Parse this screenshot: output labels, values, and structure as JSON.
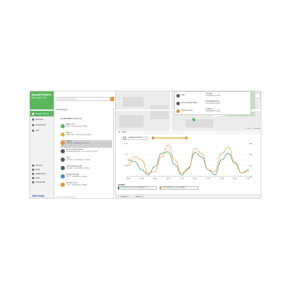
{
  "brand": {
    "logo": "Aqua4Forward",
    "subtitle": "Data Logger v1.70"
  },
  "nav": {
    "items": [
      {
        "label": "Visualizzazione",
        "active": true,
        "icon": "eye-icon"
      },
      {
        "label": "Informes",
        "active": false,
        "icon": "report-icon"
      },
      {
        "label": "Dispositivos",
        "active": false,
        "icon": "device-icon"
      },
      {
        "label": "API",
        "active": false,
        "icon": "api-icon"
      }
    ],
    "bottom": [
      {
        "label": "Account",
        "icon": "user-icon"
      },
      {
        "label": "Pixel",
        "icon": "pixel-icon"
      },
      {
        "label": "Applications",
        "icon": "apps-icon"
      },
      {
        "label": "Help",
        "icon": "help-icon"
      },
      {
        "label": "Français(ü)",
        "icon": "language-icon"
      }
    ],
    "footer_logo": "Sydrologic"
  },
  "tree": {
    "search_placeholder": "Rechercher filtre dans...",
    "root": "Hydrologic",
    "device": "DVDF0MBK2-PLUTO-04",
    "sensors": [
      {
        "name": "Battery Life",
        "value": "81 % - 11-06-2024 12:28:50",
        "color": "#5cb85c",
        "selected": false
      },
      {
        "name": "Shelter",
        "value": "0.836 mAh - 11-06-2024 12:28:50",
        "color": "#e8b13a",
        "selected": false
      },
      {
        "name": "Capteur",
        "value": "0.80 kN - 11-08-2024 12:27:30",
        "color": "#e8922b",
        "selected": true
      },
      {
        "name": "Communication Status",
        "value": "ACCESSAPP0012 - 10-07-2024 12:28:50",
        "color": "#555555",
        "selected": false
      },
      {
        "name": "GPS",
        "value": "Cd Neigs - 11-08-2024 12:28:50",
        "color": "#555555",
        "selected": false
      },
      {
        "name": "GSM Signal Strength",
        "value": "-82 dBm - 11-08-2024 12:28:50",
        "color": "#555555",
        "selected": false
      },
      {
        "name": "Relative Humidity",
        "value": "79 % - 11-08-2024 12:28:50",
        "color": "#3a8fd8",
        "selected": false
      },
      {
        "name": "Pressure / RT-1",
        "value": "1 bar - 09-08-2023 11:28:50",
        "color": "#e8922b",
        "selected": false
      }
    ],
    "footer": "© Reliure nel rechargement"
  },
  "map": {
    "popup": [
      {
        "name": "GPS",
        "v1": "Cd Neigs",
        "v2": "11-08-2024 12:28:50",
        "color": "#555555"
      },
      {
        "name": "Communication Status",
        "v1": "ACCESSAPP0012",
        "v2": "10-07-2024 12:28:50",
        "color": "#555555"
      },
      {
        "name": "Pressure / RT-1",
        "v1": "10.000 psi",
        "v2": "09-08-2023 11:28:50",
        "color": "#e8922b"
      }
    ],
    "attribution": "Leaflet | © OpenStreetMap"
  },
  "chart_header": "Zoom",
  "panel": {
    "range_label": "Range de Partout"
  },
  "chart_data": {
    "type": "line",
    "x": [
      "11:00",
      "11:02",
      "11:04",
      "11:06",
      "11:08",
      "11:10",
      "11:12",
      "11:14",
      "11:16",
      "11:18",
      "11:20",
      "11:22",
      "11:24",
      "11:26",
      "11:28",
      "11:30",
      "11:32",
      "11:34",
      "11:36"
    ],
    "categories_ticks": [
      "11:00",
      "11:04",
      "11:08",
      "11:12",
      "11:16",
      "11:20",
      "11:24",
      "11:28",
      "11:32",
      "11:36"
    ],
    "series": [
      {
        "name": "DVDF0MBK2-PLUTO-04 - Pression RT-1",
        "color": "#2e8b57",
        "values": [
          0.5,
          0.45,
          0.2,
          0.05,
          0.3,
          0.7,
          0.75,
          0.35,
          0.05,
          0.25,
          0.72,
          0.6,
          0.2,
          0.05,
          0.5,
          0.7,
          0.4,
          0.1,
          0.2
        ]
      },
      {
        "name": "DVDF0MBK2-PLUTO-04 - Capteur",
        "color": "#e8922b",
        "values": [
          0.35,
          0.6,
          0.5,
          0.1,
          0.15,
          0.6,
          0.95,
          0.5,
          0.1,
          0.2,
          0.85,
          0.7,
          0.2,
          0.15,
          0.7,
          0.9,
          0.45,
          0.1,
          0.15
        ]
      }
    ],
    "y_left_ticks": [
      "0",
      "0.25",
      "0.5",
      "0.75"
    ],
    "y_right_ticks": [
      "4.49",
      "4.51",
      "4.53",
      "4.55"
    ],
    "ylim": [
      0,
      1
    ]
  },
  "legend": {
    "title": "LEGEND"
  },
  "bottom_tabs": [
    "graphique",
    "données"
  ]
}
